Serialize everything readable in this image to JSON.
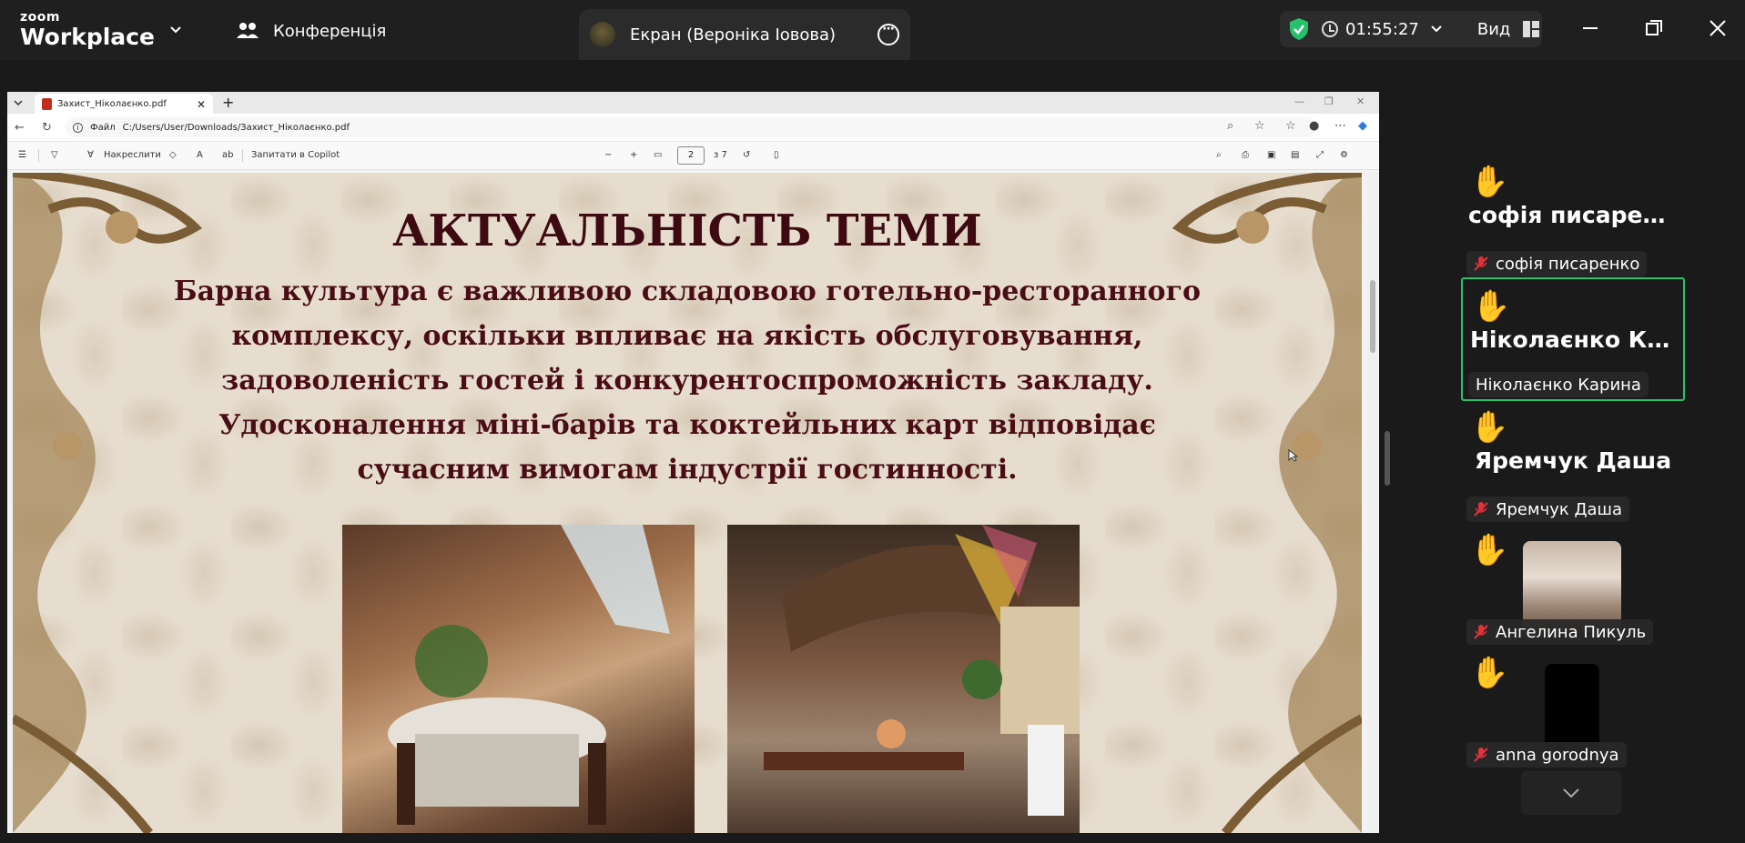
{
  "app": {
    "logo_top": "zoom",
    "logo_bottom": "Workplace",
    "meeting_label": "Конференція",
    "share_label": "Екран (Вероніка Іовова)",
    "timer": "01:55:27",
    "view_label": "Вид",
    "colors": {
      "shield": "#27c26c",
      "active_border": "#27c26c",
      "muted": "#e0323c"
    }
  },
  "browser": {
    "tab_title": "Захист_Ніколаєнко.pdf",
    "url_prefix": "Файл",
    "url": "C:/Users/User/Downloads/Захист_Ніколаєнко.pdf"
  },
  "pdf_toolbar": {
    "draw_label": "Накреслити",
    "copilot_label": "Запитати в Copilot",
    "page_current": "2",
    "page_total": "з 7"
  },
  "slide": {
    "title": "АКТУАЛЬНІСТЬ ТЕМИ",
    "body": "Барна культура є важливою складовою готельно-ресторанного комплексу, оскільки впливає на якість обслуговування, задоволеність гостей і конкурентоспроможність закладу. Удосконалення міні-барів та коктейльних карт відповідає сучасним вимогам індустрії гостинності."
  },
  "participants": [
    {
      "display": "софія писаренко",
      "label": "софія писаренко"
    },
    {
      "display": "Ніколаєнко Ка...",
      "label": "Ніколаєнко Карина",
      "active": true
    },
    {
      "display": "Яремчук Даша",
      "label": "Яремчук Даша"
    },
    {
      "display": "",
      "label": "Ангелина Пикуль"
    },
    {
      "display": "",
      "label": "anna gorodnya"
    }
  ]
}
